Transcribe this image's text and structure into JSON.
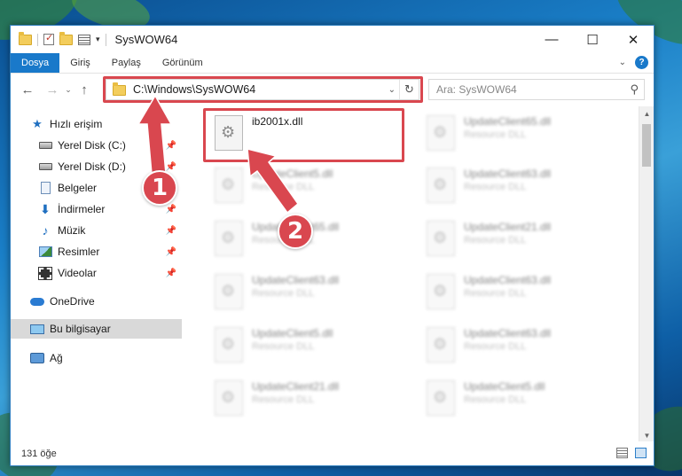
{
  "window": {
    "title": "SysWOW64",
    "controls": {
      "minimize": "—",
      "maximize": "☐",
      "close": "✕"
    }
  },
  "ribbon": {
    "tabs": [
      "Dosya",
      "Giriş",
      "Paylaş",
      "Görünüm"
    ],
    "help": "?"
  },
  "nav": {
    "address": "C:\\Windows\\SysWOW64",
    "search_placeholder": "Ara: SysWOW64"
  },
  "sidebar": {
    "items": [
      {
        "label": "Hızlı erişim",
        "icon": "star-icon"
      },
      {
        "label": "Yerel Disk (C:)",
        "icon": "drive-icon",
        "pinned": true
      },
      {
        "label": "Yerel Disk (D:)",
        "icon": "drive-icon",
        "pinned": true
      },
      {
        "label": "Belgeler",
        "icon": "documents-icon",
        "pinned": true
      },
      {
        "label": "İndirmeler",
        "icon": "downloads-icon",
        "pinned": true
      },
      {
        "label": "Müzik",
        "icon": "music-icon",
        "pinned": true
      },
      {
        "label": "Resimler",
        "icon": "pictures-icon",
        "pinned": true
      },
      {
        "label": "Videolar",
        "icon": "videos-icon",
        "pinned": true
      },
      {
        "label": "OneDrive",
        "icon": "onedrive-icon"
      },
      {
        "label": "Bu bilgisayar",
        "icon": "computer-icon",
        "selected": true
      },
      {
        "label": "Ağ",
        "icon": "network-icon"
      }
    ]
  },
  "files": {
    "highlighted": {
      "name": "ib2001x.dll"
    },
    "left_column": [
      {
        "name": "UpdateClient5.dll",
        "type": "Resource DLL"
      },
      {
        "name": "UpdateClient65.dll",
        "type": "Resource DLL"
      },
      {
        "name": "UpdateClient63.dll",
        "type": "Resource DLL"
      },
      {
        "name": "UpdateClient5.dll",
        "type": "Resource DLL"
      },
      {
        "name": "UpdateClient21.dll",
        "type": "Resource DLL"
      }
    ],
    "right_column": [
      {
        "name": "UpdateClient65.dll",
        "type": "Resource DLL"
      },
      {
        "name": "UpdateClient63.dll",
        "type": "Resource DLL"
      },
      {
        "name": "UpdateClient21.dll",
        "type": "Resource DLL"
      },
      {
        "name": "UpdateClient63.dll",
        "type": "Resource DLL"
      },
      {
        "name": "UpdateClient63.dll",
        "type": "Resource DLL"
      },
      {
        "name": "UpdateClient5.dll",
        "type": "Resource DLL"
      }
    ]
  },
  "status": {
    "item_count": "131 öğe"
  },
  "annotations": {
    "step1": "1",
    "step2": "2"
  },
  "colors": {
    "accent": "#1979ca",
    "highlight": "#d9474f"
  }
}
